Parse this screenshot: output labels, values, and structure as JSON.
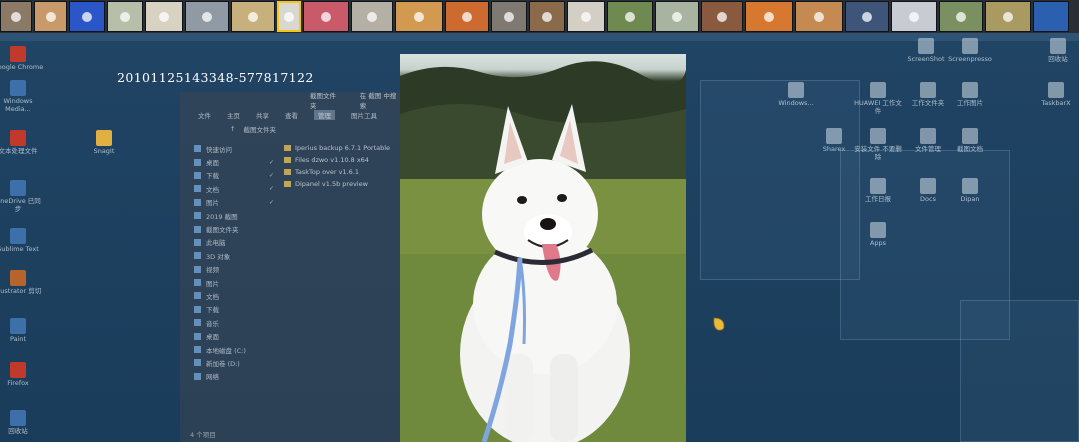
{
  "viewer": {
    "filename": "20101125143348-577817122"
  },
  "thumbnails": [
    {
      "name": "thumb-1",
      "color": "#8a7a66"
    },
    {
      "name": "thumb-2",
      "color": "#c89a6a"
    },
    {
      "name": "thumb-3",
      "color": "#2a56c8"
    },
    {
      "name": "thumb-4",
      "color": "#b8bfa8"
    },
    {
      "name": "thumb-5",
      "color": "#d7d2c2"
    },
    {
      "name": "thumb-6",
      "color": "#8f9aa4"
    },
    {
      "name": "thumb-7",
      "color": "#c8b07c"
    },
    {
      "name": "thumb-8",
      "color": "#d8d8d0"
    },
    {
      "name": "thumb-9",
      "color": "#c85a6a"
    },
    {
      "name": "thumb-10",
      "color": "#b4b0a6"
    },
    {
      "name": "thumb-11",
      "color": "#d29a50"
    },
    {
      "name": "thumb-12",
      "color": "#cc6a30"
    },
    {
      "name": "thumb-13",
      "color": "#7e7a72"
    },
    {
      "name": "thumb-14",
      "color": "#8a6a4a"
    },
    {
      "name": "thumb-15",
      "color": "#d4cfc4"
    },
    {
      "name": "thumb-16",
      "color": "#6f8a50"
    },
    {
      "name": "thumb-17",
      "color": "#a8b4a0"
    },
    {
      "name": "thumb-18",
      "color": "#8a5a3e"
    },
    {
      "name": "thumb-19",
      "color": "#d67830"
    },
    {
      "name": "thumb-20",
      "color": "#c48a52"
    },
    {
      "name": "thumb-21",
      "color": "#3e5478"
    },
    {
      "name": "thumb-22",
      "color": "#c8ccd2"
    },
    {
      "name": "thumb-23",
      "color": "#7a9060"
    },
    {
      "name": "thumb-24",
      "color": "#a89a60"
    },
    {
      "name": "thumb-25",
      "color": "#2b5fb0"
    }
  ],
  "selected_thumbnail_index": 7,
  "desktop_left_icons": [
    {
      "label": "Google Chrome"
    },
    {
      "label": "Windows Media..."
    },
    {
      "label": "文本处理文件"
    },
    {
      "label": "SnagIt"
    },
    {
      "label": "OneDrive 已同步"
    },
    {
      "label": "Sublime Text"
    },
    {
      "label": "Illustrator 剪切"
    },
    {
      "label": "Paint"
    },
    {
      "label": "Firefox"
    },
    {
      "label": "回收站"
    }
  ],
  "desktop_right_icons": [
    {
      "label": "ScreenShot"
    },
    {
      "label": "Screenpresso"
    },
    {
      "label": "回收站"
    },
    {
      "label": "Windows..."
    },
    {
      "label": "HUAWEI 工作文件"
    },
    {
      "label": "工作文件夹"
    },
    {
      "label": "工作图片"
    },
    {
      "label": "TaskbarX"
    },
    {
      "label": "Sharex"
    },
    {
      "label": "安装文件 不要删除"
    },
    {
      "label": "文件管理"
    },
    {
      "label": "截图文档"
    },
    {
      "label": "工作日报"
    },
    {
      "label": "Docs"
    },
    {
      "label": "Dipan"
    },
    {
      "label": "Apps"
    }
  ],
  "explorer": {
    "title": "截图文件夹",
    "search_label": "在 截图 中搜索",
    "tabs": [
      "文件",
      "主页",
      "共享",
      "查看",
      "管理",
      "图片工具"
    ],
    "address": "截图文件夹",
    "nav": [
      {
        "label": "快速访问",
        "pinned": false
      },
      {
        "label": "桌面",
        "pinned": true
      },
      {
        "label": "下载",
        "pinned": true
      },
      {
        "label": "文档",
        "pinned": true
      },
      {
        "label": "图片",
        "pinned": true
      },
      {
        "label": "2019 截图",
        "pinned": false
      },
      {
        "label": "截图文件夹",
        "pinned": false
      },
      {
        "label": "此电脑",
        "pinned": false
      },
      {
        "label": "3D 对象",
        "pinned": false
      },
      {
        "label": "视频",
        "pinned": false
      },
      {
        "label": "图片",
        "pinned": false
      },
      {
        "label": "文档",
        "pinned": false
      },
      {
        "label": "下载",
        "pinned": false
      },
      {
        "label": "音乐",
        "pinned": false
      },
      {
        "label": "桌面",
        "pinned": false
      },
      {
        "label": "本地磁盘 (C:)",
        "pinned": false
      },
      {
        "label": "新加卷 (D:)",
        "pinned": false
      },
      {
        "label": "网络",
        "pinned": false
      }
    ],
    "files": [
      "Iperius backup 6.7.1 Portable",
      "Files dzwo v1.10.8 x64",
      "TaskTop over v1.6.1",
      "Dipanel v1.5b preview"
    ],
    "status": "4 个项目"
  }
}
